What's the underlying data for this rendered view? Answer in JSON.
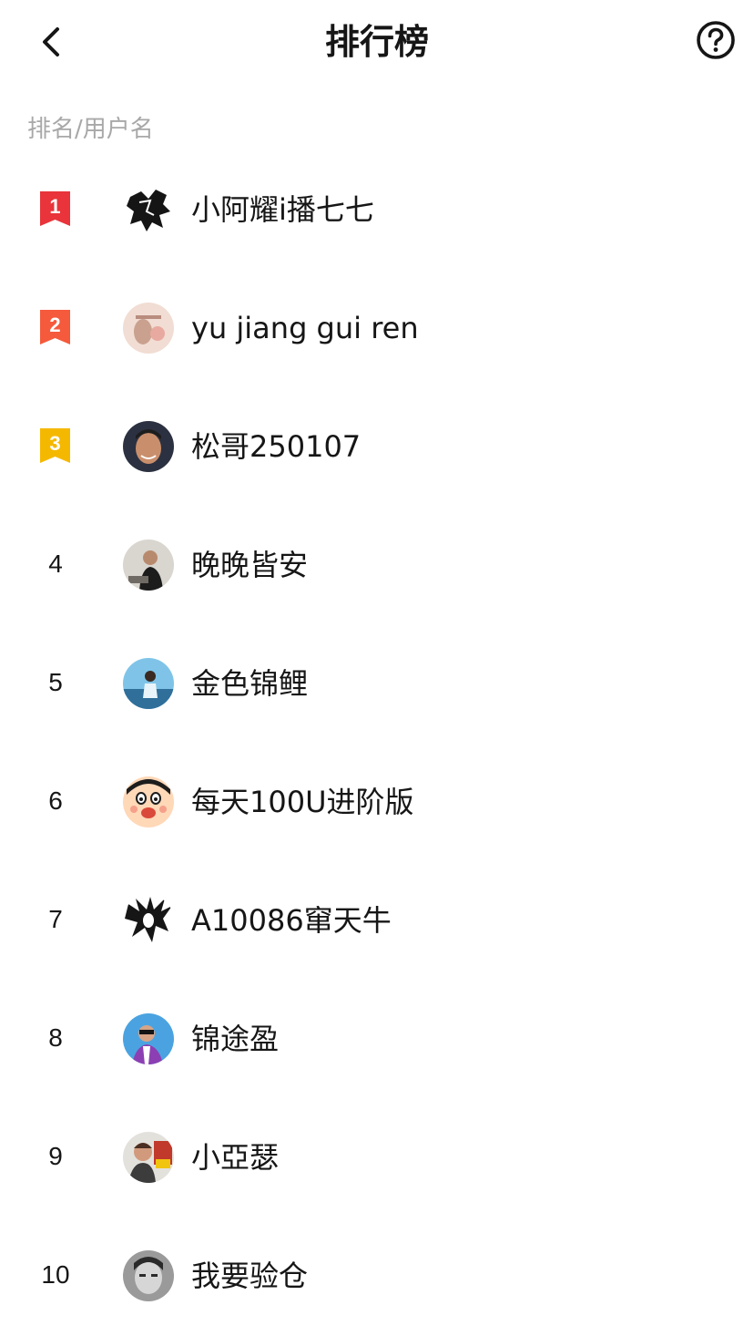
{
  "header": {
    "title": "排行榜",
    "back_icon": "chevron-left-icon",
    "help_icon": "question-circle-icon"
  },
  "column_header": "排名/用户名",
  "colors": {
    "rank1": "#e8343a",
    "rank2": "#f55a3c",
    "rank3": "#f5b800",
    "text": "#161616",
    "muted": "#a8a8a8"
  },
  "rows": [
    {
      "rank": "1",
      "name": "小阿耀i播七七"
    },
    {
      "rank": "2",
      "name": "yu jiang gui ren"
    },
    {
      "rank": "3",
      "name": "松哥250107"
    },
    {
      "rank": "4",
      "name": "晚晚皆安"
    },
    {
      "rank": "5",
      "name": "金色锦鲤"
    },
    {
      "rank": "6",
      "name": "每天100U进阶版"
    },
    {
      "rank": "7",
      "name": "A10086窜天牛"
    },
    {
      "rank": "8",
      "name": "锦途盈"
    },
    {
      "rank": "9",
      "name": "小亞瑟"
    },
    {
      "rank": "10",
      "name": "我要验仓"
    }
  ]
}
